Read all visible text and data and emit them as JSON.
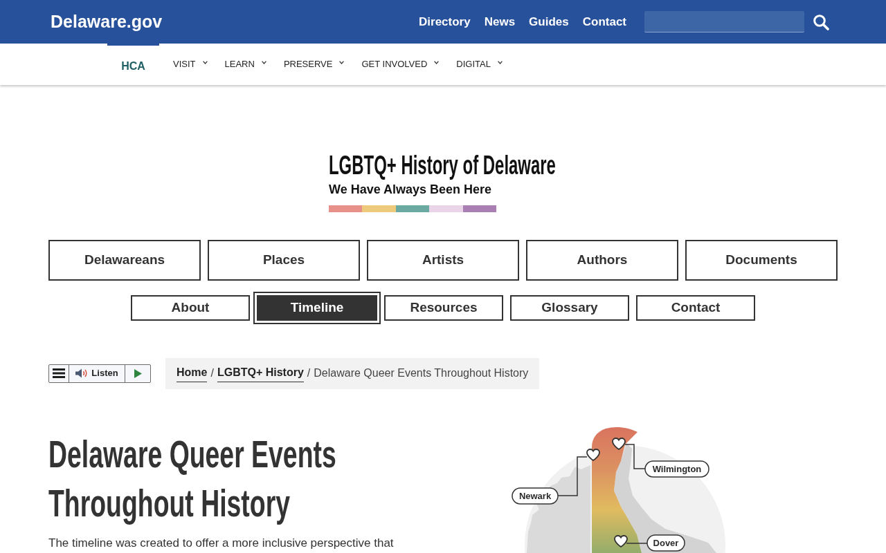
{
  "header": {
    "site_title": "Delaware.gov",
    "links": [
      "Directory",
      "News",
      "Guides",
      "Contact"
    ]
  },
  "agency_nav": {
    "brand": "HCA",
    "items": [
      "VISIT",
      "LEARN",
      "PRESERVE",
      "GET INVOLVED",
      "DIGITAL"
    ]
  },
  "logo": {
    "title": "LGBTQ+ History of Delaware",
    "tagline": "We Have Always Been Here"
  },
  "primary_tabs": [
    {
      "label": "Delawareans",
      "selected": false
    },
    {
      "label": "Places",
      "selected": false
    },
    {
      "label": "Artists",
      "selected": false
    },
    {
      "label": "Authors",
      "selected": false
    },
    {
      "label": "Documents",
      "selected": false
    }
  ],
  "secondary_tabs": [
    {
      "label": "About",
      "selected": false
    },
    {
      "label": "Timeline",
      "selected": true
    },
    {
      "label": "Resources",
      "selected": false
    },
    {
      "label": "Glossary",
      "selected": false
    },
    {
      "label": "Contact",
      "selected": false
    }
  ],
  "audio_player": {
    "listen_label": "Listen"
  },
  "breadcrumb": {
    "items": [
      {
        "label": "Home",
        "current": false
      },
      {
        "separator": "/",
        "label": "LGBTQ+ History",
        "current": false
      },
      {
        "separator": "/",
        "label": "Delaware Queer Events Throughout History",
        "current": true
      }
    ]
  },
  "page": {
    "title": "Delaware Queer Events Throughout History",
    "intro": "The timeline was created to offer a more inclusive perspective that"
  },
  "map": {
    "places": [
      {
        "label": "Wilmington"
      },
      {
        "label": "Newark"
      },
      {
        "label": "Dover"
      }
    ]
  }
}
